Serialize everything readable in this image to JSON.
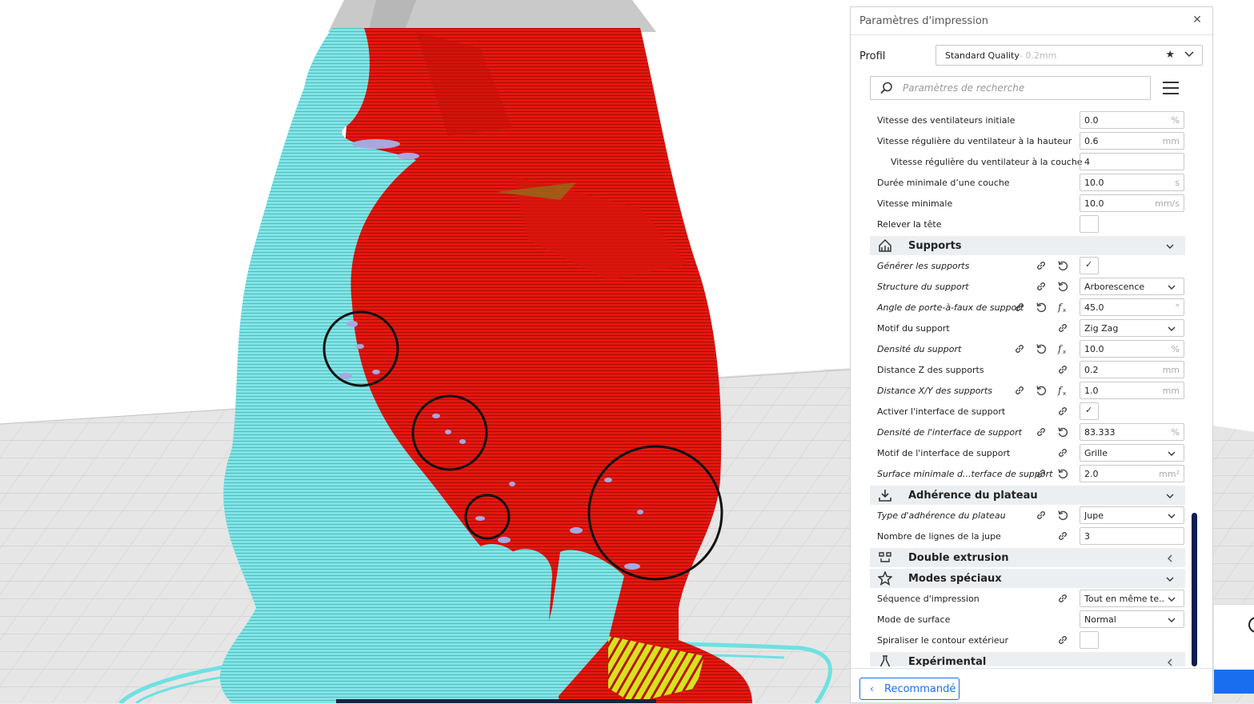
{
  "panel": {
    "title": "Paramètres d'impression",
    "close_icon": "close-icon",
    "profile_label": "Profil",
    "profile_name": "Standard Quality",
    "profile_sub": "- 0.2mm",
    "search_placeholder": "Paramètres de recherche",
    "footer_button": "Recommandé"
  },
  "rows": [
    {
      "label": "Vitesse des ventilateurs initiale",
      "value": "0.0",
      "unit": "%"
    },
    {
      "label": "Vitesse régulière du ventilateur à la hauteur",
      "value": "0.6",
      "unit": "mm"
    },
    {
      "label": "Vitesse régulière du ventilateur à la couche",
      "value": "4",
      "unit": ""
    },
    {
      "label": "Durée minimale d’une couche",
      "value": "10.0",
      "unit": "s"
    },
    {
      "label": "Vitesse minimale",
      "value": "10.0",
      "unit": "mm/s"
    },
    {
      "label": "Relever la tête",
      "value": "",
      "unit": ""
    },
    {
      "label": "Supports"
    },
    {
      "label": "Générer les supports",
      "value": "✓",
      "unit": ""
    },
    {
      "label": "Structure du support",
      "value": "Arborescence",
      "unit": ""
    },
    {
      "label": "Angle de porte-à-faux de support",
      "value": "45.0",
      "unit": "°"
    },
    {
      "label": "Motif du support",
      "value": "Zig Zag",
      "unit": ""
    },
    {
      "label": "Densité du support",
      "value": "10.0",
      "unit": "%"
    },
    {
      "label": "Distance Z des supports",
      "value": "0.2",
      "unit": "mm"
    },
    {
      "label": "Distance X/Y des supports",
      "value": "1.0",
      "unit": "mm"
    },
    {
      "label": "Activer l'interface de support",
      "value": "✓",
      "unit": ""
    },
    {
      "label": "Densité de l'interface de support",
      "value": "83.333",
      "unit": "%"
    },
    {
      "label": "Motif de l'interface de support",
      "value": "Grille",
      "unit": ""
    },
    {
      "label": "Surface minimale d...terface de support",
      "value": "2.0",
      "unit": "mm²"
    },
    {
      "label": "Adhérence du plateau"
    },
    {
      "label": "Type d'adhérence du plateau",
      "value": "Jupe",
      "unit": ""
    },
    {
      "label": "Nombre de lignes de la jupe",
      "value": "3",
      "unit": ""
    },
    {
      "label": "Double extrusion"
    },
    {
      "label": "Modes spéciaux"
    },
    {
      "label": "Séquence d'impression",
      "value": "Tout en même te...",
      "unit": ""
    },
    {
      "label": "Mode de surface",
      "value": "Normal",
      "unit": ""
    },
    {
      "label": "Spiraliser le contour extérieur",
      "value": "",
      "unit": ""
    },
    {
      "label": "Expérimental"
    }
  ],
  "colors": {
    "accent": "#196ef0",
    "model_red": "#e5170f",
    "support_cyan": "#7fe3e4",
    "overhang_lavender": "#a7a8e0",
    "scrollbar": "#0c1f4e"
  }
}
